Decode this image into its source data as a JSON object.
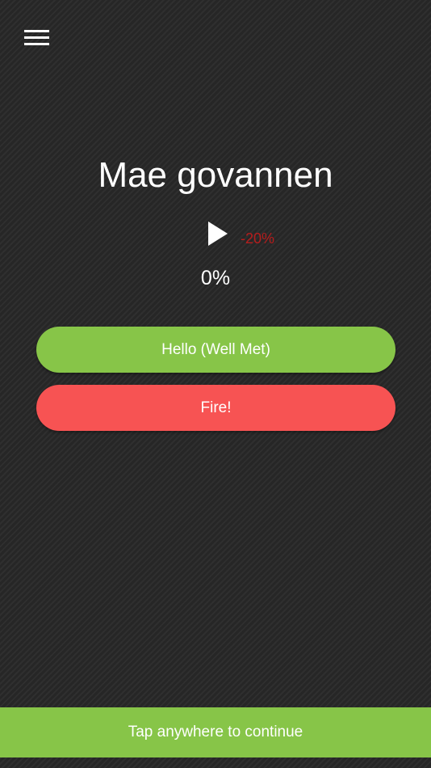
{
  "header": {
    "menu_icon": "hamburger-menu-icon"
  },
  "card": {
    "title": "Mae govannen",
    "play_icon": "play-icon",
    "speed_label": "-20%",
    "progress_text": "0%",
    "progress_value": 0
  },
  "answers": [
    {
      "label": "Hello (Well Met)",
      "color": "#87c548"
    },
    {
      "label": "Fire!",
      "color": "#f75353"
    }
  ],
  "footer": {
    "continue_label": "Tap anywhere to continue",
    "color": "#87c548"
  },
  "colors": {
    "background": "#2b2b2b",
    "accent_green": "#87c548",
    "accent_red": "#f75353",
    "speed_red": "#b51d1d"
  }
}
